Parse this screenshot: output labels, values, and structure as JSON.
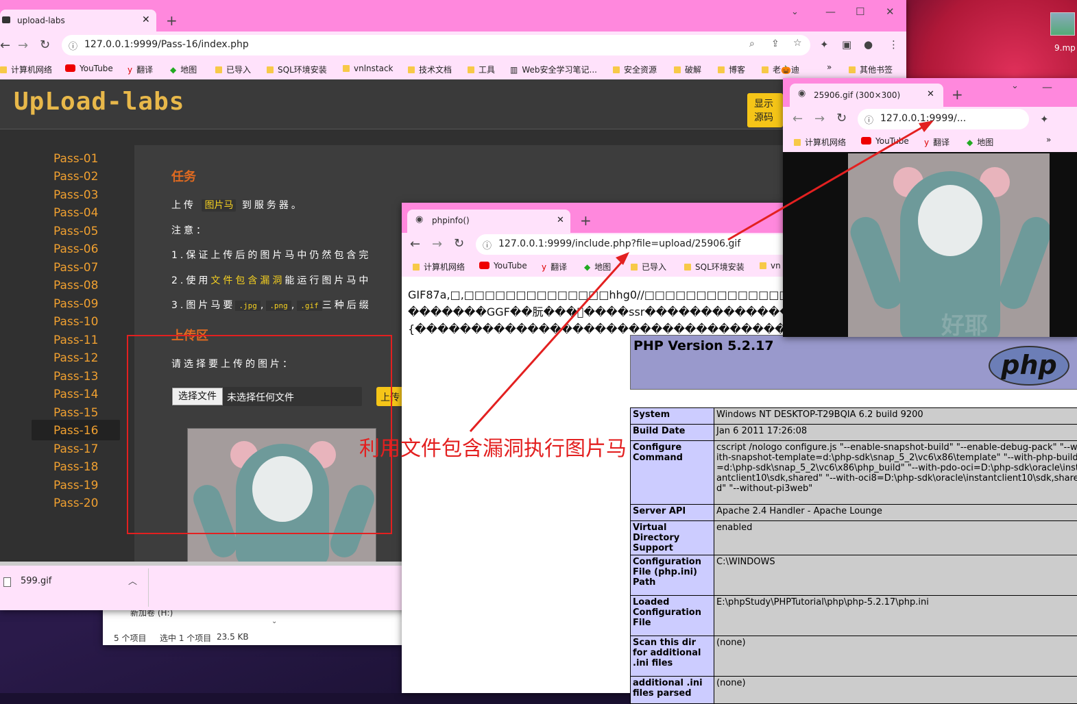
{
  "win1": {
    "tab_title": "upload-labs",
    "url": "127.0.0.1:9999/Pass-16/index.php"
  },
  "bookmarks1": [
    "计算机网络",
    "YouTube",
    "翻译",
    "地图",
    "已导入",
    "SQL环境安装",
    "vnlnstack",
    "技术文档",
    "工具",
    "Web安全学习笔记...",
    "安全资源",
    "破解",
    "博客",
    "老🎃迪",
    "其他书签"
  ],
  "upload": {
    "logo": "UpLoad-labs",
    "show_source": "显示源码",
    "passes": [
      "Pass-01",
      "Pass-02",
      "Pass-03",
      "Pass-04",
      "Pass-05",
      "Pass-06",
      "Pass-07",
      "Pass-08",
      "Pass-09",
      "Pass-10",
      "Pass-11",
      "Pass-12",
      "Pass-13",
      "Pass-14",
      "Pass-15",
      "Pass-16",
      "Pass-17",
      "Pass-18",
      "Pass-19",
      "Pass-20"
    ],
    "active": "Pass-16",
    "task_title": "任务",
    "task_pre": "上传",
    "task_hl": "图片马",
    "task_post": "到服务器。",
    "note": "注意：",
    "n1": "1.保证上传后的图片马中仍然包含完",
    "n2_pre": "2.使用",
    "n2_hl": "文件包含漏洞",
    "n2_post": "能运行图片马中",
    "n3_pre": "3.图片马要",
    "ext1": ".jpg",
    "ext2": ".png",
    "ext3": ".gif",
    "n3_post": "三种后缀",
    "upload_title": "上传区",
    "choose_label": "请选择要上传的图片：",
    "file_button": "选择文件",
    "no_file": "未选择任何文件",
    "upload_button": "上传"
  },
  "win2": {
    "tab_title": "phpinfo()",
    "url": "127.0.0.1:9999/include.php?file=upload/25906.gif",
    "bookmarks": [
      "计算机网络",
      "YouTube",
      "翻译",
      "地图",
      "已导入",
      "SQL环境安装",
      "vn"
    ],
    "garbage": [
      "GIF87a,□,□□□□□□□□□□□□□□hhg0//□□□□□□□□□□□□□□□□□□□□□□",
      "�������GGF��朊���\u0000����ssr��������������",
      "{�����������������������������������"
    ],
    "php_version": "PHP Version 5.2.17",
    "php_logo": "php",
    "rows": [
      [
        "System",
        "Windows NT DESKTOP-T29BQIA 6.2 build 9200"
      ],
      [
        "Build Date",
        "Jan 6 2011 17:26:08"
      ],
      [
        "Configure Command",
        "cscript /nologo configure.js \"--enable-snapshot-build\" \"--enable-debug-pack\" \"--with-snapshot-template=d:\\php-sdk\\snap_5_2\\vc6\\x86\\template\" \"--with-php-build=d:\\php-sdk\\snap_5_2\\vc6\\x86\\php_build\" \"--with-pdo-oci=D:\\php-sdk\\oracle\\instantclient10\\sdk,shared\" \"--with-oci8=D:\\php-sdk\\oracle\\instantclient10\\sdk,shared\" \"--without-pi3web\""
      ],
      [
        "Server API",
        "Apache 2.4 Handler - Apache Lounge"
      ],
      [
        "Virtual Directory Support",
        "enabled"
      ],
      [
        "Configuration File (php.ini) Path",
        "C:\\WINDOWS"
      ],
      [
        "Loaded Configuration File",
        "E:\\phpStudy\\PHPTutorial\\php\\php-5.2.17\\php.ini"
      ],
      [
        "Scan this dir for additional .ini files",
        "(none)"
      ],
      [
        "additional .ini files parsed",
        "(none)"
      ]
    ]
  },
  "win3": {
    "tab_title": "25906.gif (300×300)",
    "url": "127.0.0.1:9999/...",
    "bookmarks": [
      "计算机网络",
      "YouTube",
      "翻译",
      "地图"
    ],
    "caption": "好耶"
  },
  "annotation": "利用文件包含漏洞执行图片马",
  "download": {
    "file": "599.gif"
  },
  "explorer": {
    "drive": "新加卷 (H:)",
    "count": "5 个项目",
    "selected": "选中 1 个项目",
    "size": "23.5 KB"
  },
  "desktop": {
    "file": "9.mp"
  }
}
